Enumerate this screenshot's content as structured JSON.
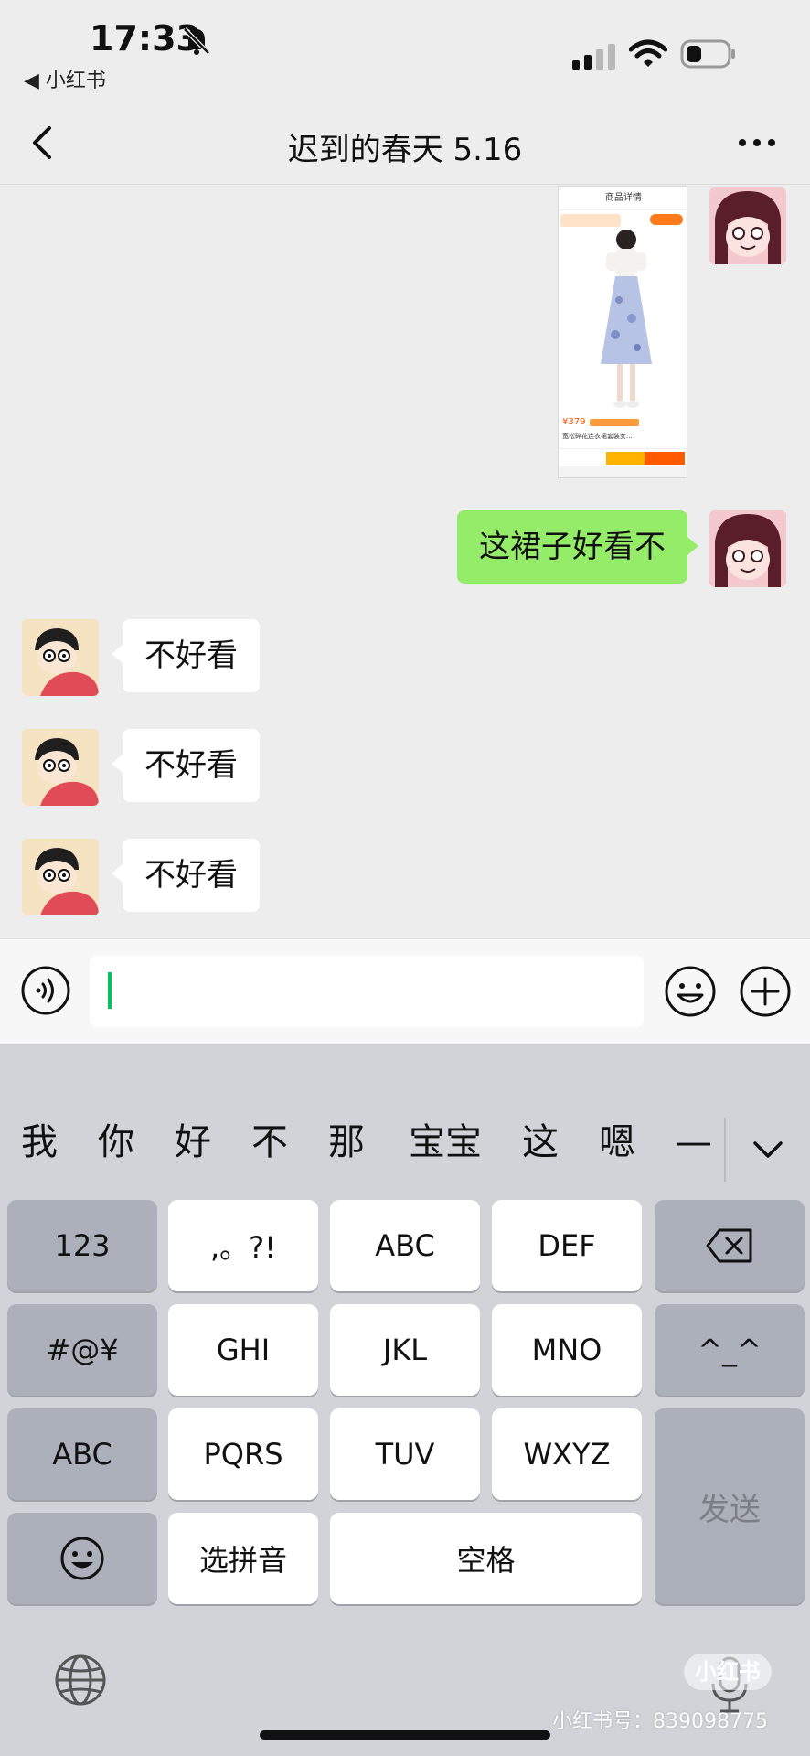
{
  "status_bar": {
    "time": "17:33",
    "back_app": "◀ 小红书"
  },
  "nav": {
    "title": "迟到的春天 5.16"
  },
  "messages": [
    {
      "side": "me",
      "type": "image",
      "content": ""
    },
    {
      "side": "me",
      "type": "text",
      "content": "这裙子好看不"
    },
    {
      "side": "other",
      "type": "text",
      "content": "不好看"
    },
    {
      "side": "other",
      "type": "text",
      "content": "不好看"
    },
    {
      "side": "other",
      "type": "text",
      "content": "不好看"
    }
  ],
  "shared_image": {
    "header": "商品详情",
    "price": "¥379",
    "product_line": "宽松碎花连衣裙套装女..."
  },
  "input": {
    "value": ""
  },
  "keyboard": {
    "candidates": [
      "我",
      "你",
      "好",
      "不",
      "那",
      "宝宝",
      "这",
      "嗯",
      "—"
    ],
    "rows": [
      [
        "123",
        ",。?!",
        "ABC",
        "DEF",
        "⌫"
      ],
      [
        "#@¥",
        "GHI",
        "JKL",
        "MNO",
        "^_^"
      ],
      [
        "ABC",
        "PQRS",
        "TUV",
        "WXYZ"
      ],
      [
        "☺",
        "选拼音",
        "空格",
        "发送"
      ]
    ]
  },
  "watermark": {
    "badge": "小红书",
    "text": "小红书号：839098775"
  },
  "colors": {
    "chat_bg": "#ededed",
    "bubble_me": "#95ec69",
    "bubble_other": "#ffffff",
    "keyboard_bg": "#d1d3d9",
    "caret": "#07c160"
  }
}
